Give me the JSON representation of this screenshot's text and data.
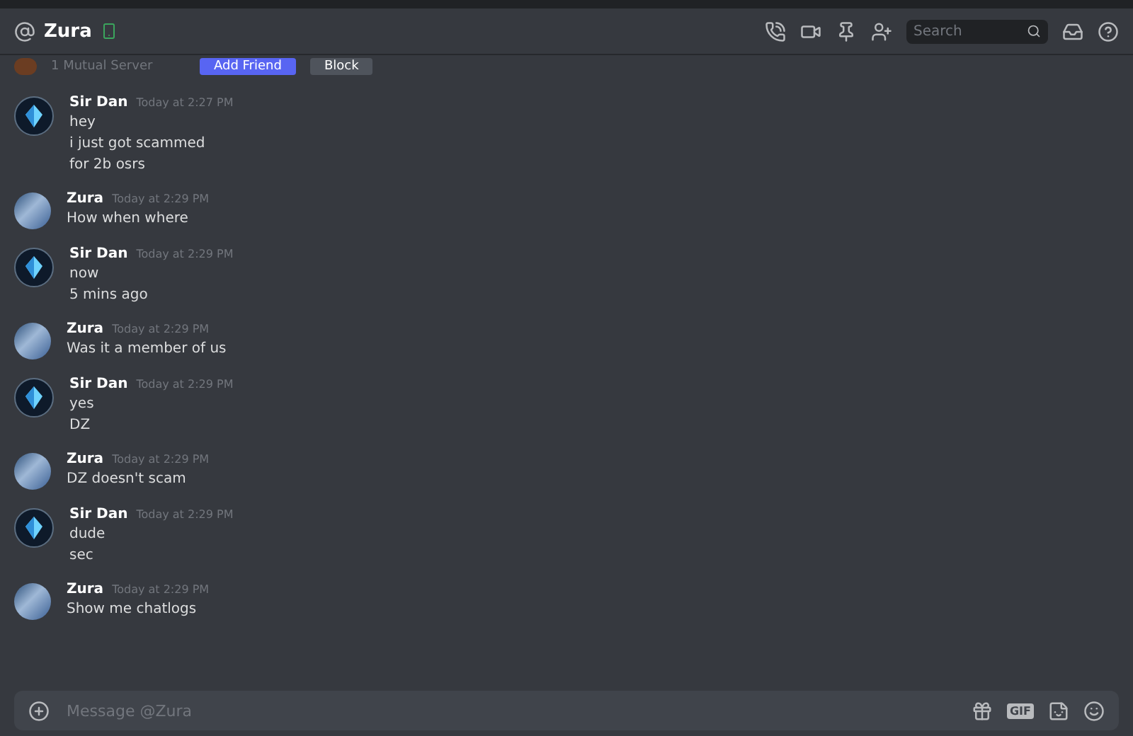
{
  "header": {
    "name": "Zura",
    "search": {
      "placeholder": "Search"
    }
  },
  "profile": {
    "mutual": "1 Mutual Server",
    "buttons": [
      "Add Friend",
      "Block"
    ]
  },
  "messages": [
    {
      "author": "Sir Dan",
      "kind": "crystal",
      "time": "Today at 2:27 PM",
      "lines": [
        "hey",
        "i just got scammed",
        "for 2b osrs"
      ]
    },
    {
      "author": "Zura",
      "kind": "art",
      "time": "Today at 2:29 PM",
      "lines": [
        "How when where"
      ]
    },
    {
      "author": "Sir Dan",
      "kind": "crystal",
      "time": "Today at 2:29 PM",
      "lines": [
        "now",
        "5 mins ago"
      ]
    },
    {
      "author": "Zura",
      "kind": "art",
      "time": "Today at 2:29 PM",
      "lines": [
        "Was it a member of us"
      ]
    },
    {
      "author": "Sir Dan",
      "kind": "crystal",
      "time": "Today at 2:29 PM",
      "lines": [
        "yes",
        "DZ"
      ]
    },
    {
      "author": "Zura",
      "kind": "art",
      "time": "Today at 2:29 PM",
      "lines": [
        "DZ doesn't scam"
      ]
    },
    {
      "author": "Sir Dan",
      "kind": "crystal",
      "time": "Today at 2:29 PM",
      "lines": [
        "dude",
        "sec"
      ]
    },
    {
      "author": "Zura",
      "kind": "art",
      "time": "Today at 2:29 PM",
      "lines": [
        "Show me chatlogs"
      ]
    }
  ],
  "composer": {
    "placeholder": "Message @Zura",
    "gif": "GIF"
  }
}
